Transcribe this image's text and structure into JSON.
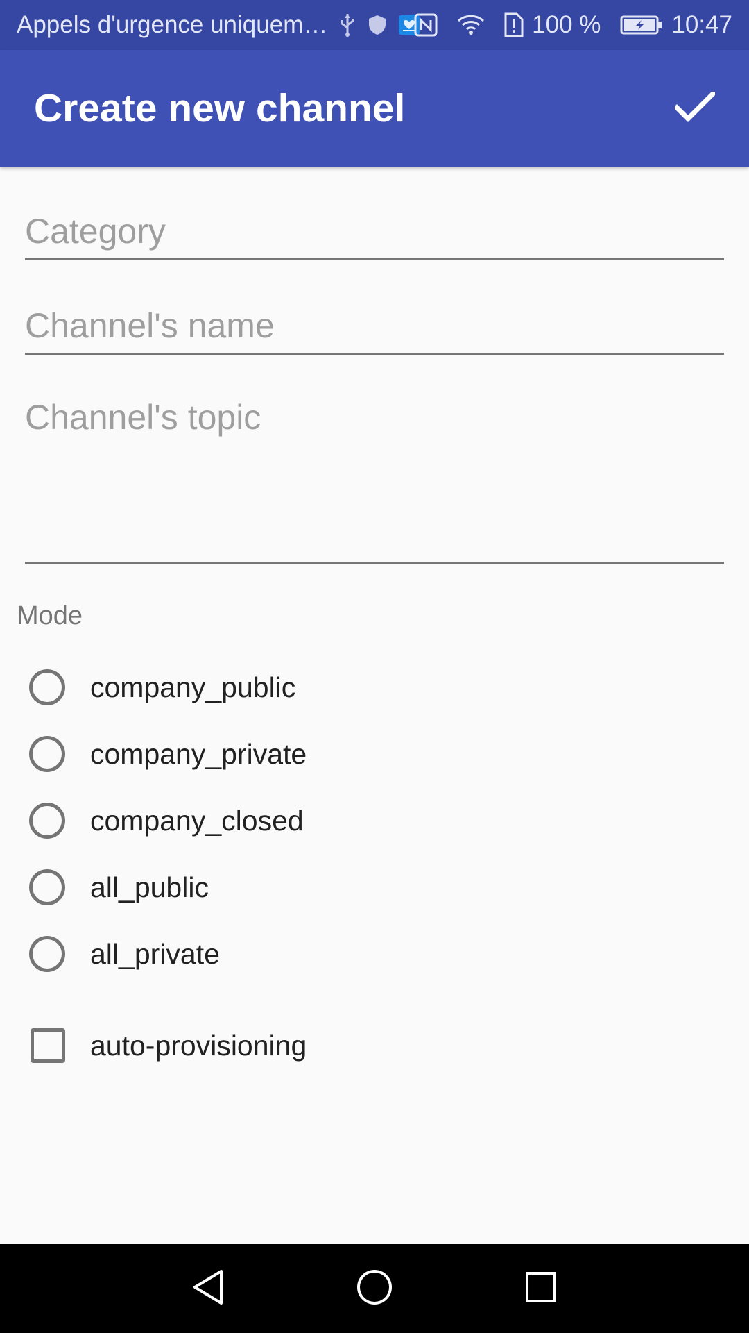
{
  "status_bar": {
    "carrier_text": "Appels d'urgence uniquem…",
    "battery_percent": "100 %",
    "time": "10:47",
    "icons": [
      "usb-icon",
      "shield-icon",
      "app-notification-icon",
      "nfc-icon",
      "wifi-icon",
      "sim-alert-icon",
      "battery-charging-icon"
    ]
  },
  "app_bar": {
    "title": "Create new channel",
    "confirm_icon": "check-icon"
  },
  "form": {
    "category_placeholder": "Category",
    "name_placeholder": "Channel's name",
    "topic_placeholder": "Channel's topic",
    "category_value": "",
    "name_value": "",
    "topic_value": ""
  },
  "mode": {
    "label": "Mode",
    "options": [
      {
        "label": "company_public",
        "selected": false
      },
      {
        "label": "company_private",
        "selected": false
      },
      {
        "label": "company_closed",
        "selected": false
      },
      {
        "label": "all_public",
        "selected": false
      },
      {
        "label": "all_private",
        "selected": false
      }
    ]
  },
  "auto_provisioning": {
    "label": "auto-provisioning",
    "checked": false
  },
  "nav_bar": {
    "icons": [
      "back-icon",
      "home-icon",
      "recents-icon"
    ]
  },
  "colors": {
    "status_bar": "#3646a3",
    "app_bar": "#3f51b5",
    "background": "#fafafa",
    "control_gray": "#757575",
    "placeholder_gray": "#9e9e9e"
  }
}
